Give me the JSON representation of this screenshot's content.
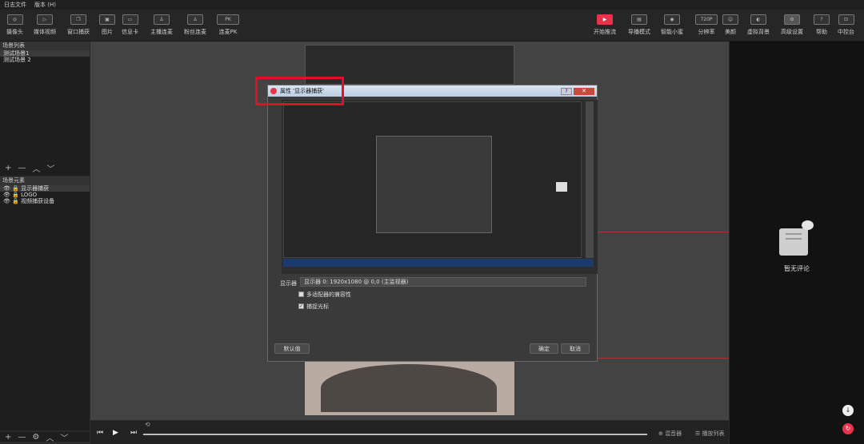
{
  "menubar": {
    "items": [
      "日志文件",
      "版本 (H)"
    ]
  },
  "toolbar_left": [
    {
      "label": "摄像头",
      "icon": "camera-icon",
      "glyph": "◎"
    },
    {
      "label": "媒体视频",
      "icon": "play-icon",
      "glyph": "▷"
    },
    {
      "label": "窗口捕获",
      "icon": "window-icon",
      "glyph": "❐"
    },
    {
      "label": "图片",
      "icon": "image-icon",
      "glyph": "▣"
    },
    {
      "label": "信息卡",
      "icon": "card-icon",
      "glyph": "▭"
    },
    {
      "label": "主播连麦",
      "icon": "user-link-icon",
      "glyph": "♙"
    },
    {
      "label": "粉丝连麦",
      "icon": "fans-link-icon",
      "glyph": "♙"
    },
    {
      "label": "连麦PK",
      "icon": "pk-icon",
      "glyph": "PK"
    }
  ],
  "toolbar_right": [
    {
      "label": "开始推流",
      "icon": "stream-icon",
      "glyph": "▶"
    },
    {
      "label": "导播模式",
      "icon": "director-icon",
      "glyph": "▤"
    },
    {
      "label": "智能小蜜",
      "icon": "assistant-icon",
      "glyph": "◉"
    },
    {
      "label": "分辨率",
      "icon": "resolution-icon",
      "glyph": "720P"
    },
    {
      "label": "美颜",
      "icon": "beauty-icon",
      "glyph": "☺"
    },
    {
      "label": "虚拟背景",
      "icon": "virtual-bg-icon",
      "glyph": "◐"
    },
    {
      "label": "高级设置",
      "icon": "settings-icon",
      "glyph": "⚙"
    },
    {
      "label": "帮助",
      "icon": "help-icon",
      "glyph": "?"
    },
    {
      "label": "中控台",
      "icon": "console-icon",
      "glyph": "⊡"
    }
  ],
  "scenes": {
    "title": "场景列表",
    "items": [
      "测试场景1",
      "测试场景 2"
    ]
  },
  "elements": {
    "title": "场景元素",
    "items": [
      "显示器捕获",
      "LOGO",
      "视频捕获设备"
    ]
  },
  "dialog": {
    "title": "属性 '显示器捕获'",
    "display_label": "显示器",
    "display_value": "显示器 0: 1920x1080 @ 0,0 (主监视器)",
    "multi_adapter": "多适配器的兼容性",
    "capture_cursor": "捕捉光标",
    "default_btn": "默认值",
    "ok_btn": "确定",
    "cancel_btn": "取消"
  },
  "right_panel": {
    "empty_text": "暂无评论"
  },
  "playbar": {
    "mixer": "混音器",
    "playlist": "播放列表"
  },
  "colors": {
    "accent": "#e8334a",
    "highlight_box": "#e0102a"
  }
}
